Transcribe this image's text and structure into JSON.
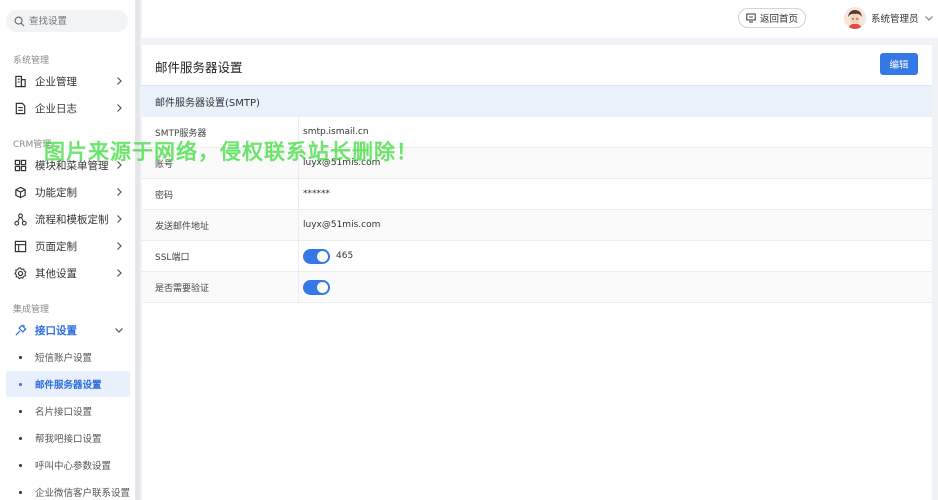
{
  "search": {
    "placeholder": "查找设置"
  },
  "sidebar": {
    "sections": [
      "系统管理",
      "CRM管理",
      "集成管理"
    ],
    "items": [
      {
        "label": "企业管理",
        "icon": "building-icon"
      },
      {
        "label": "企业日志",
        "icon": "document-icon"
      },
      {
        "label": "模块和菜单管理",
        "icon": "grid-icon"
      },
      {
        "label": "功能定制",
        "icon": "cube-icon"
      },
      {
        "label": "流程和模板定制",
        "icon": "flow-icon"
      },
      {
        "label": "页面定制",
        "icon": "page-icon"
      },
      {
        "label": "其他设置",
        "icon": "gear-icon"
      },
      {
        "label": "接口设置",
        "icon": "plug-icon"
      }
    ],
    "sub_items": [
      "短信账户设置",
      "邮件服务器设置",
      "名片接口设置",
      "帮我吧接口设置",
      "呼叫中心参数设置",
      "企业微信客户联系设置"
    ]
  },
  "header": {
    "back_label": "返回首页",
    "user_name": "系统管理员"
  },
  "main": {
    "title": "邮件服务器设置",
    "edit_label": "编辑",
    "section_title": "邮件服务器设置(SMTP)",
    "fields": [
      {
        "label": "SMTP服务器",
        "value": "smtp.ismail.cn"
      },
      {
        "label": "账号",
        "value": "luyx@51mis.com"
      },
      {
        "label": "密码",
        "value": "******"
      },
      {
        "label": "发送邮件地址",
        "value": "luyx@51mis.com"
      },
      {
        "label": "SSL端口",
        "value": "465"
      },
      {
        "label": "是否需要验证",
        "value": ""
      }
    ]
  },
  "watermark": "图片来源于网络，侵权联系站长删除！",
  "colors": {
    "accent": "#3478e6",
    "active_bg": "#e8f0fd",
    "section_bg": "#e9f1fb",
    "watermark": "#3cdc3c"
  }
}
